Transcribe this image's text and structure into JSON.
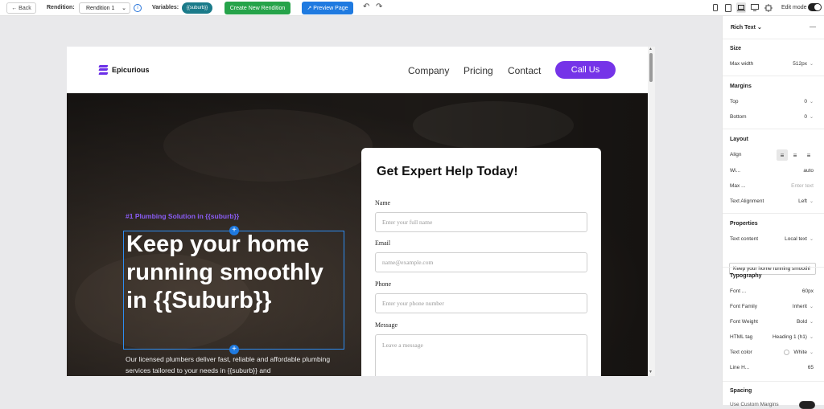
{
  "toolbar": {
    "back_label": "← Back",
    "rendition_label": "Rendition:",
    "rendition_value": "Rendition 1",
    "variables_label": "Variables:",
    "variable_chip": "{{suburb}}",
    "create_label": "Create New Rendition",
    "preview_label": "↗ Preview Page",
    "undo_icon": "↶",
    "redo_icon": "↷",
    "devices": [
      "mobile-icon",
      "tablet-icon",
      "laptop-icon",
      "desktop-icon",
      "responsive-icon"
    ],
    "active_device": "laptop-icon",
    "edit_mode_label": "Edit mode",
    "edit_mode_on": true
  },
  "site": {
    "logo_text": "Epicurious",
    "nav": [
      "Company",
      "Pricing",
      "Contact"
    ],
    "cta": "Call Us",
    "accent": "#7534e8",
    "hero": {
      "tagline": "#1 Plumbing Solution in {{suburb}}",
      "headline": "Keep your home running smoothly in {{Suburb}}",
      "description": "Our licensed plumbers deliver fast, reliable and affordable plumbing services tailored to your needs in {{suburb}} and"
    },
    "form": {
      "title": "Get Expert Help Today!",
      "fields": [
        {
          "label": "Name",
          "placeholder": "Enter your full name"
        },
        {
          "label": "Email",
          "placeholder": "name@example.com"
        },
        {
          "label": "Phone",
          "placeholder": "Enter your phone number"
        },
        {
          "label": "Message",
          "placeholder": "Leave a message"
        }
      ]
    }
  },
  "panel": {
    "title": "Rich Text",
    "title_chevron": "⌄",
    "collapse_icon": "—",
    "size": {
      "section": "Size",
      "max_width_label": "Max width",
      "max_width_value": "512px"
    },
    "margins": {
      "section": "Margins",
      "top_label": "Top",
      "top_value": "0",
      "bottom_label": "Bottom",
      "bottom_value": "0"
    },
    "layout": {
      "section": "Layout",
      "align_label": "Align",
      "width_label": "Wi...",
      "width_value": "auto",
      "max_label": "Max ...",
      "max_placeholder": "Enter text",
      "text_align_label": "Text Alignment",
      "text_align_value": "Left"
    },
    "properties": {
      "section": "Properties",
      "content_label": "Text content",
      "content_value": "Local text",
      "content_text": "Keep your home running smoothl"
    },
    "typography": {
      "section": "Typography",
      "font_size_label": "Font ...",
      "font_size_value": "60px",
      "family_label": "Font Family",
      "family_value": "Inherit",
      "weight_label": "Font Weight",
      "weight_value": "Bold",
      "tag_label": "HTML tag",
      "tag_value": "Heading 1 (h1)",
      "color_label": "Text color",
      "color_value": "White",
      "line_label": "Line H...",
      "line_value": "65"
    },
    "spacing": {
      "section": "Spacing",
      "custom_margins_label": "Use Custom Margins"
    }
  }
}
